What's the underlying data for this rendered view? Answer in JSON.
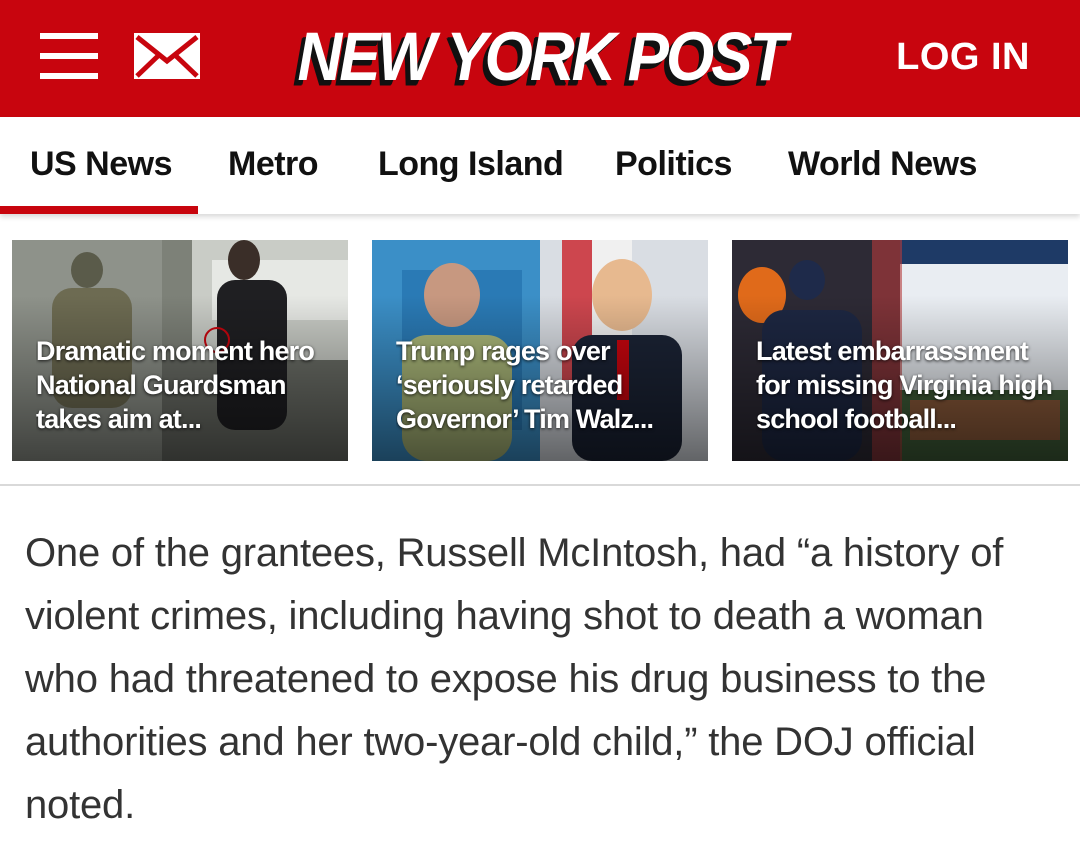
{
  "header": {
    "logo_text": "NEW YORK POST",
    "login_label": "LOG IN",
    "menu_icon": "hamburger-menu-icon",
    "mail_icon": "envelope-icon",
    "brand_color": "#c8050e"
  },
  "nav": {
    "tabs": [
      {
        "label": "US News",
        "active": true
      },
      {
        "label": "Metro",
        "active": false
      },
      {
        "label": "Long Island",
        "active": false
      },
      {
        "label": "Politics",
        "active": false
      },
      {
        "label": "World News",
        "active": false
      }
    ]
  },
  "stories": [
    {
      "headline": "Dramatic moment hero National Guardsman takes aim at..."
    },
    {
      "headline": "Trump rages over ‘seriously retarded Governor’ Tim Walz..."
    },
    {
      "headline": "Latest embarrassment for missing Virginia high school football..."
    }
  ],
  "article": {
    "paragraph": "One of the grantees, Russell McIntosh, had “a history of violent crimes, including having shot to death a woman who had threatened to expose his drug business to the authorities and her two-year-old child,” the DOJ official noted."
  }
}
